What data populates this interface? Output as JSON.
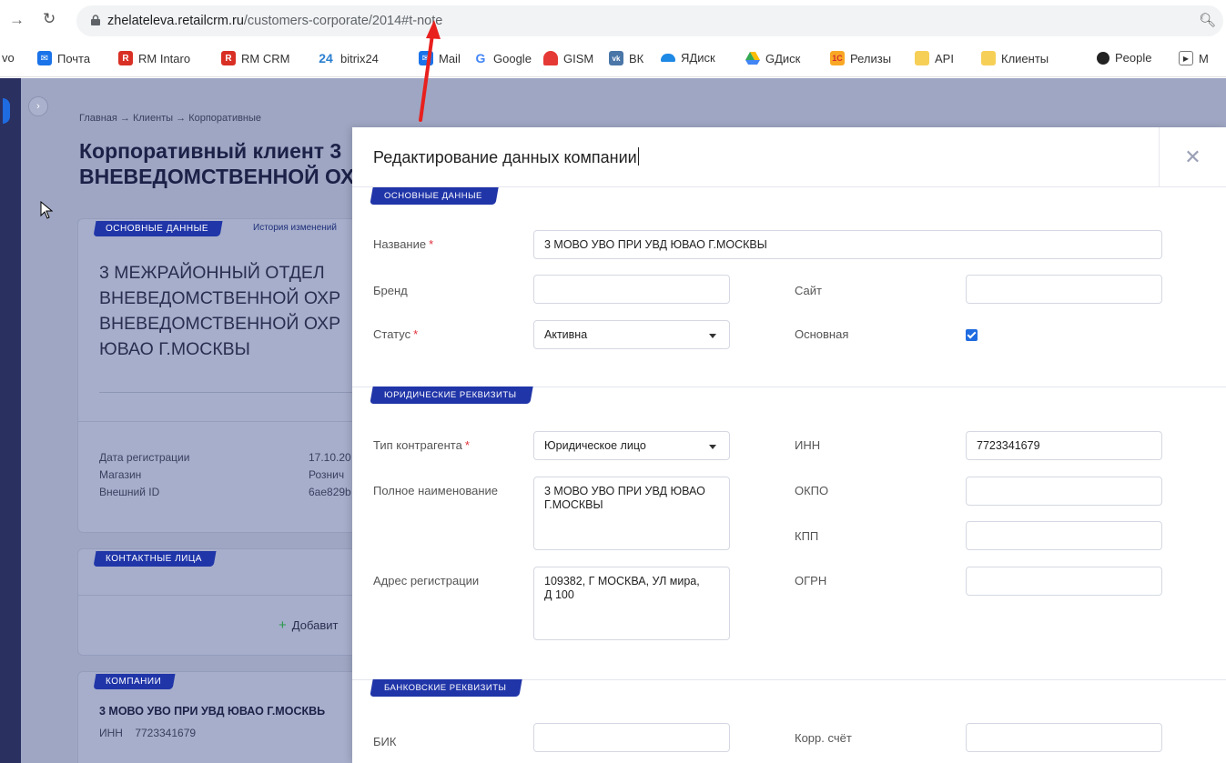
{
  "browser": {
    "url_host": "zhelateleva.retailcrm.ru",
    "url_path": "/customers-corporate/2014#t-note"
  },
  "bookmarks": [
    {
      "label": "vo",
      "icon": "",
      "color": ""
    },
    {
      "label": "Почта",
      "icon": "mail-icon",
      "color": "#1a73e8"
    },
    {
      "label": "RM Intaro",
      "icon": "R",
      "color": "#d93025"
    },
    {
      "label": "RM CRM",
      "icon": "R",
      "color": "#d93025"
    },
    {
      "label": "bitrix24",
      "icon": "24",
      "color": "#2fc6f6"
    },
    {
      "label": "Mail",
      "icon": "mail-icon",
      "color": "#1a73e8"
    },
    {
      "label": "Google",
      "icon": "G",
      "color": "#4285f4"
    },
    {
      "label": "GISM",
      "icon": "umbrella-icon",
      "color": "#e53935"
    },
    {
      "label": "ВК",
      "icon": "vk",
      "color": "#4a76a8"
    },
    {
      "label": "ЯДиск",
      "icon": "disk-icon",
      "color": "#1e88e5"
    },
    {
      "label": "GДиск",
      "icon": "drive-icon",
      "color": "#34a853"
    },
    {
      "label": "Релизы",
      "icon": "1c",
      "color": "#f9a825"
    },
    {
      "label": "API",
      "icon": "folder-icon",
      "color": "#f6cf57"
    },
    {
      "label": "Клиенты",
      "icon": "folder-icon",
      "color": "#f6cf57"
    },
    {
      "label": "People",
      "icon": "circle-icon",
      "color": "#222222"
    },
    {
      "label": "M",
      "icon": "play-icon",
      "color": "#555555"
    }
  ],
  "background": {
    "breadcrumb": "Главная → Клиенты → Корпоративные",
    "title_line1": "Корпоративный клиент 3",
    "title_line2": "ВНЕВЕДОМСТВЕННОЙ ОХ",
    "main_tag": "ОСНОВНЫЕ ДАННЫЕ",
    "history_link": "История изменений",
    "name_lines": [
      "3 МЕЖРАЙОННЫЙ ОТДЕЛ",
      "ВНЕВЕДОМСТВЕННОЙ ОХР",
      "ВНЕВЕДОМСТВЕННОЙ ОХР",
      "ЮВАО Г.МОСКВЫ"
    ],
    "reg_date_label": "Дата регистрации",
    "reg_date_value": "17.10.20",
    "shop_label": "Магазин",
    "shop_value": "Рознич",
    "ext_id_label": "Внешний ID",
    "ext_id_value": "6ae829b",
    "contacts_tag": "КОНТАКТНЫЕ ЛИЦА",
    "add_label": "Добавит",
    "companies_tag": "КОМПАНИИ",
    "company_name": "3 МОВО УВО ПРИ УВД ЮВАО Г.МОСКВЬ",
    "company_inn_label": "ИНН",
    "company_inn_value": "7723341679"
  },
  "modal": {
    "title": "Редактирование данных компании",
    "sections": {
      "main": "ОСНОВНЫЕ ДАННЫЕ",
      "legal": "ЮРИДИЧЕСКИЕ РЕКВИЗИТЫ",
      "bank": "БАНКОВСКИЕ РЕКВИЗИТЫ"
    },
    "fields": {
      "name_label": "Название",
      "name_value": "3 МОВО УВО ПРИ УВД ЮВАО Г.МОСКВЫ",
      "brand_label": "Бренд",
      "brand_value": "",
      "site_label": "Сайт",
      "site_value": "",
      "status_label": "Статус",
      "status_value": "Активна",
      "main_label": "Основная",
      "main_checked": true,
      "type_label": "Тип контрагента",
      "type_value": "Юридическое лицо",
      "inn_label": "ИНН",
      "inn_value": "7723341679",
      "fullname_label": "Полное наименование",
      "fullname_value": "3 МОВО УВО ПРИ УВД ЮВАО\nГ.МОСКВЫ",
      "okpo_label": "ОКПО",
      "okpo_value": "",
      "kpp_label": "КПП",
      "kpp_value": "",
      "address_label": "Адрес регистрации",
      "address_value": "109382, Г МОСКВА, УЛ мира,\nД 100",
      "ogrn_label": "ОГРН",
      "ogrn_value": "",
      "bik_label": "БИК",
      "bik_value": "",
      "corr_label": "Корр. счёт",
      "corr_value": ""
    },
    "required_mark": "*"
  }
}
